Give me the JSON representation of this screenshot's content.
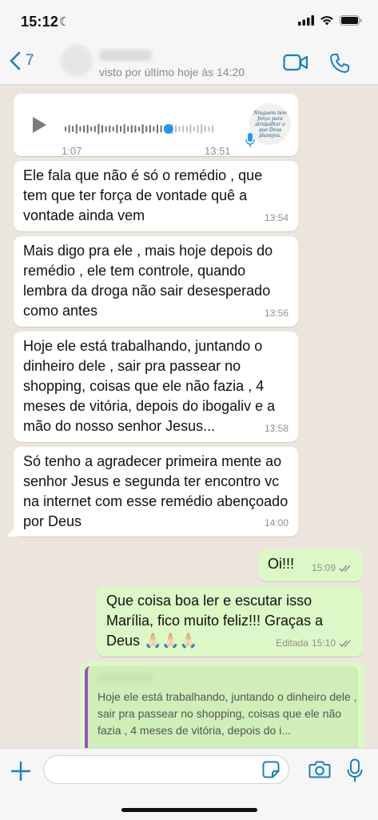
{
  "status": {
    "time": "15:12"
  },
  "header": {
    "back_count": "7",
    "last_seen": "visto por último hoje às 14:20"
  },
  "voice_message": {
    "duration": "1:07",
    "time": "13:51",
    "avatar_text": "Ninguém tem força para atrapalhar o que Deus planejou."
  },
  "messages": [
    {
      "text": "Ele fala que não é só o remédio , que tem que ter força de vontade quê a vontade ainda vem",
      "time": "13:54"
    },
    {
      "text": "Mais digo pra ele , mais hoje depois do remédio , ele tem controle, quando lembra da droga não sair desesperado como antes",
      "time": "13:56"
    },
    {
      "text": "Hoje ele está trabalhando, juntando o dinheiro dele , sair pra passear no shopping, coisas que ele não fazia , 4 meses de vitória, depois do ibogaliv e a mão do nosso senhor Jesus...",
      "time": "13:58"
    },
    {
      "text": "Só tenho a agradecer primeira mente ao senhor Jesus e segunda ter encontro vc na internet com esse remédio abençoado por Deus",
      "time": "14:00"
    }
  ],
  "outgoing": [
    {
      "text": "Oi!!!",
      "time": "15:09"
    },
    {
      "text": "Que coisa boa ler e escutar isso Marília, fico muito feliz!!! Graças a Deus 🙏🏻🙏🏻🙏🏻",
      "edited": "Editada",
      "time": "15:10"
    }
  ],
  "quote": {
    "text": "Hoje ele está trabalhando, juntando o dinheiro dele , sair pra passear no shopping, coisas que ele não fazia , 4 meses de vitória, depois do i..."
  },
  "colors": {
    "accent": "#1a7fc1",
    "incoming_bg": "#ffffff",
    "outgoing_bg": "#dcf8c6",
    "chat_bg": "#ece5dd",
    "quote_bar": "#9b4fc8",
    "voice_dot": "#2196f3"
  }
}
